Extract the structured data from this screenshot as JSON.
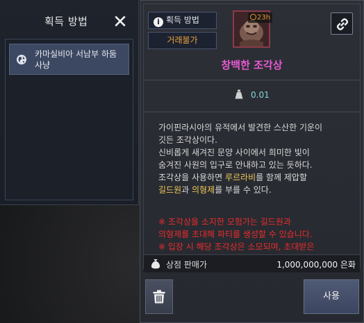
{
  "acquisition_panel": {
    "title": "획득 방법",
    "sources": [
      {
        "label": "카마실비아 서남부 하둠 사냥"
      }
    ]
  },
  "item": {
    "tag_acquisition": "획득 방법",
    "tag_trade": "거래불가",
    "timer": "23h",
    "name": "창백한 조각상",
    "weight": "0.01",
    "description_lines": [
      "가이핀라시아의 유적에서 발견한 스산한 기운이",
      "깃든 조각상이다.",
      "신비롭게 새겨진 문양 사이에서 희미한 빛이",
      "숨겨진 사원의 입구로 안내하고 있는 듯하다.",
      "조각상을 사용하면 ",
      "루르라비",
      "를 함께 제압할",
      "길드원",
      "과 ",
      "의형제",
      "를 부를 수 있다."
    ],
    "warnings": [
      "※ 조각상을 소지한 모험가는 길드원과",
      "의형제를 초대해 파티를 생성할 수 있습니다.",
      "※ 입장 시 해당 조각상은 소모되며, 초대받은"
    ],
    "price_label": "상점 판매가",
    "price_value": "1,000,000,000 은화",
    "use_label": "사용"
  },
  "colors": {
    "item_name": "#e85ad2",
    "trade_tag": "#e8a33c",
    "highlight": "#f1c85a",
    "warning": "#ea2c2c",
    "weight": "#86d9d5"
  },
  "icons": [
    "close-icon",
    "globe-icon",
    "info-icon",
    "clock-icon",
    "link-icon",
    "weight-icon",
    "bag-icon",
    "trash-icon"
  ]
}
